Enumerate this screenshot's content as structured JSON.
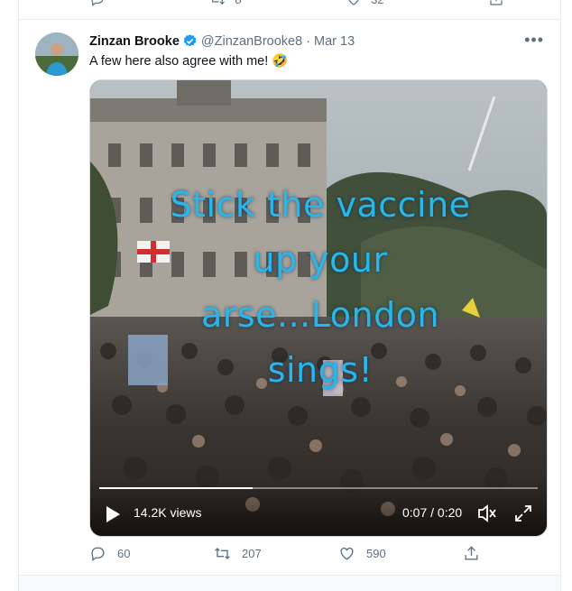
{
  "tweet": {
    "name": "Zinzan Brooke",
    "handle": "@ZinzanBrooke8",
    "separator": "·",
    "date": "Mar 13",
    "text": "A few here also agree with me! 🤣",
    "more_label": "•••"
  },
  "video": {
    "overlay_lines": [
      "Stick the vaccine",
      "up your",
      "arse...London",
      "sings!"
    ],
    "views": "14.2K views",
    "time": "0:07 / 0:20",
    "progress_fraction": 0.35
  },
  "actions": {
    "reply_count": "60",
    "retweet_count": "207",
    "like_count": "590"
  },
  "previous_tweet": {
    "retweet_count": "8",
    "like_count": "32"
  },
  "colors": {
    "accent": "#1d9bf0",
    "muted": "#5b7083",
    "border": "#e6ecf0",
    "overlay_text": "#29b6e8"
  },
  "icons": [
    "verified-badge-icon",
    "more-icon",
    "play-icon",
    "mute-icon",
    "fullscreen-icon",
    "reply-icon",
    "retweet-icon",
    "like-icon",
    "share-icon"
  ]
}
